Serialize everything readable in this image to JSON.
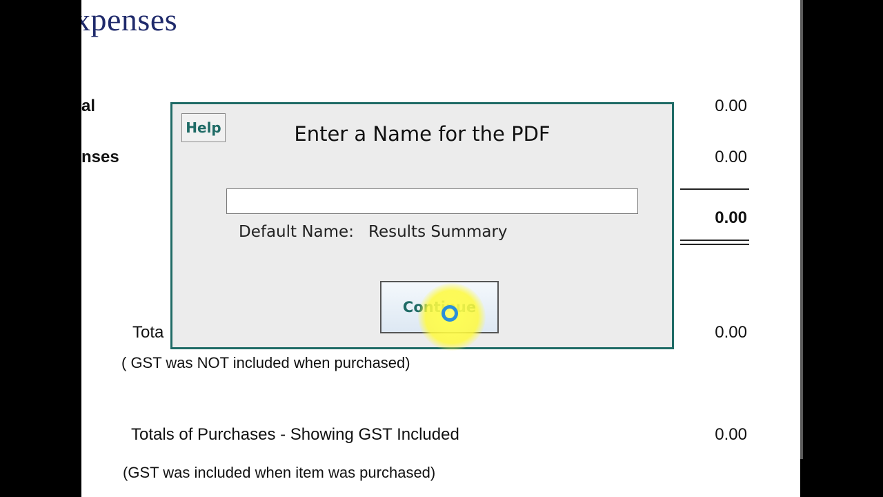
{
  "page": {
    "heading": "xpenses",
    "rows": [
      {
        "label": "al",
        "value": "0.00"
      },
      {
        "label": "nses",
        "value": "0.00"
      }
    ],
    "total_value": "0.00",
    "purchases_not_included": {
      "label": "Tota",
      "note": "( GST was NOT included when purchased)",
      "value": "0.00"
    },
    "purchases_included": {
      "label": "Totals of Purchases - Showing GST Included",
      "note": "(GST was included when item was purchased)",
      "value": "0.00"
    }
  },
  "dialog": {
    "help_label": "Help",
    "title": "Enter a Name for the PDF",
    "input_value": "",
    "default_label": "Default Name:",
    "default_value": "Results Summary",
    "continue_label": "Continue"
  },
  "colors": {
    "accent": "#1f6b66",
    "heading": "#1f2a6b",
    "cursor_highlight": "#ffff50",
    "cursor_ring": "#2b8fd8"
  }
}
